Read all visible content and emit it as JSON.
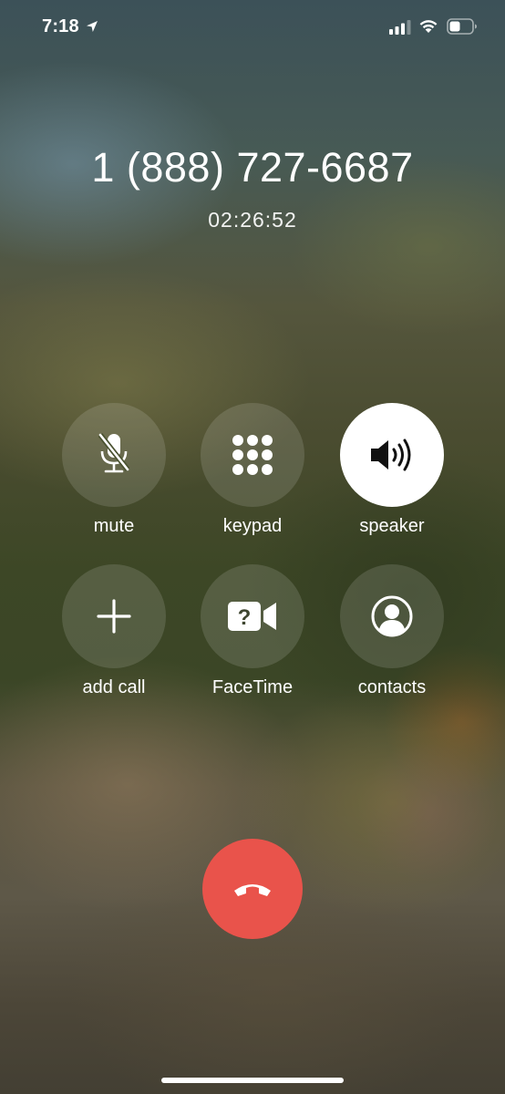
{
  "status_bar": {
    "time": "7:18",
    "icons": [
      "location-arrow-icon",
      "cellular-signal-icon",
      "wifi-icon",
      "battery-icon"
    ]
  },
  "call": {
    "number": "1 (888) 727-6687",
    "duration": "02:26:52"
  },
  "controls": {
    "mute": {
      "label": "mute",
      "icon": "mic-off-icon",
      "active": false
    },
    "keypad": {
      "label": "keypad",
      "icon": "keypad-icon",
      "active": false
    },
    "speaker": {
      "label": "speaker",
      "icon": "speaker-icon",
      "active": true
    },
    "add_call": {
      "label": "add call",
      "icon": "plus-icon",
      "active": false
    },
    "facetime": {
      "label": "FaceTime",
      "icon": "facetime-unknown-icon",
      "active": false
    },
    "contacts": {
      "label": "contacts",
      "icon": "person-circle-icon",
      "active": false
    }
  },
  "end_call": {
    "icon": "end-call-icon"
  },
  "colors": {
    "end_call": "#e9534b",
    "active_button": "#ffffff",
    "active_icon": "#111111"
  }
}
